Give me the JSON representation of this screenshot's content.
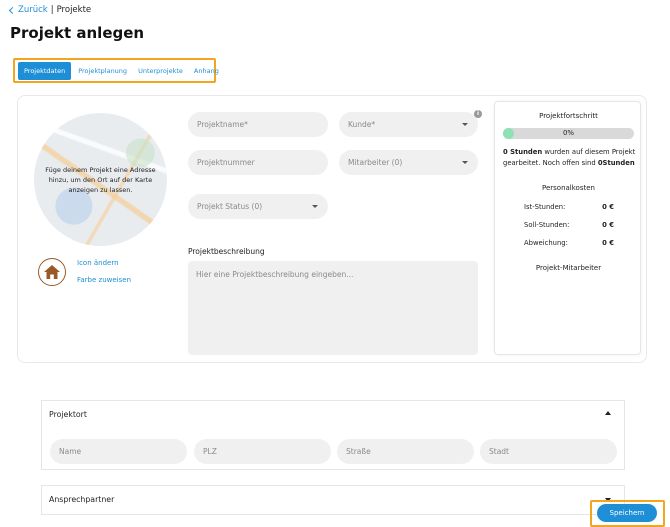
{
  "breadcrumb": {
    "back_label": "Zurück",
    "separator": "|",
    "current": "Projekte"
  },
  "page_title": "Projekt anlegen",
  "tabs": [
    {
      "label": "Projektdaten",
      "active": true
    },
    {
      "label": "Projektplanung",
      "active": false
    },
    {
      "label": "Unterprojekte",
      "active": false
    },
    {
      "label": "Anhang",
      "active": false
    }
  ],
  "map": {
    "hint": "Füge deinem Projekt eine Adresse hinzu, um den Ort auf der Karte anzeigen zu lassen."
  },
  "icon_actions": {
    "change_icon": "Icon ändern",
    "assign_color": "Farbe zuweisen"
  },
  "form": {
    "project_name_placeholder": "Projektname*",
    "customer_placeholder": "Kunde*",
    "project_number_placeholder": "Projektnummer",
    "employees_placeholder": "Mitarbeiter (0)",
    "status_placeholder": "Projekt Status (0)",
    "description_label": "Projektbeschreibung",
    "description_placeholder": "Hier eine Projektbeschreibung eingeben..."
  },
  "progress_panel": {
    "title": "Projektfortschritt",
    "percent_label": "0%",
    "percent_value": 0,
    "hours_bold_1": "0 Stunden",
    "hours_text": " wurden auf diesem Projekt gearbeitet. Noch offen sind ",
    "hours_bold_2": "0Stunden",
    "costs_title": "Personalkosten",
    "costs": [
      {
        "label": "Ist-Stunden:",
        "value": "0 €"
      },
      {
        "label": "Soll-Stunden:",
        "value": "0 €"
      },
      {
        "label": "Abweichung:",
        "value": "0 €"
      }
    ],
    "employees_title": "Projekt-Mitarbeiter"
  },
  "location_section": {
    "title": "Projektort",
    "fields": [
      "Name",
      "PLZ",
      "Straße",
      "Stadt"
    ]
  },
  "contact_section": {
    "title": "Ansprechpartner"
  },
  "save_label": "Speichern",
  "colors": {
    "accent": "#1e8fd6",
    "highlight": "#f3a51f",
    "progress": "#8fe0b4",
    "house": "#9a5a28"
  }
}
